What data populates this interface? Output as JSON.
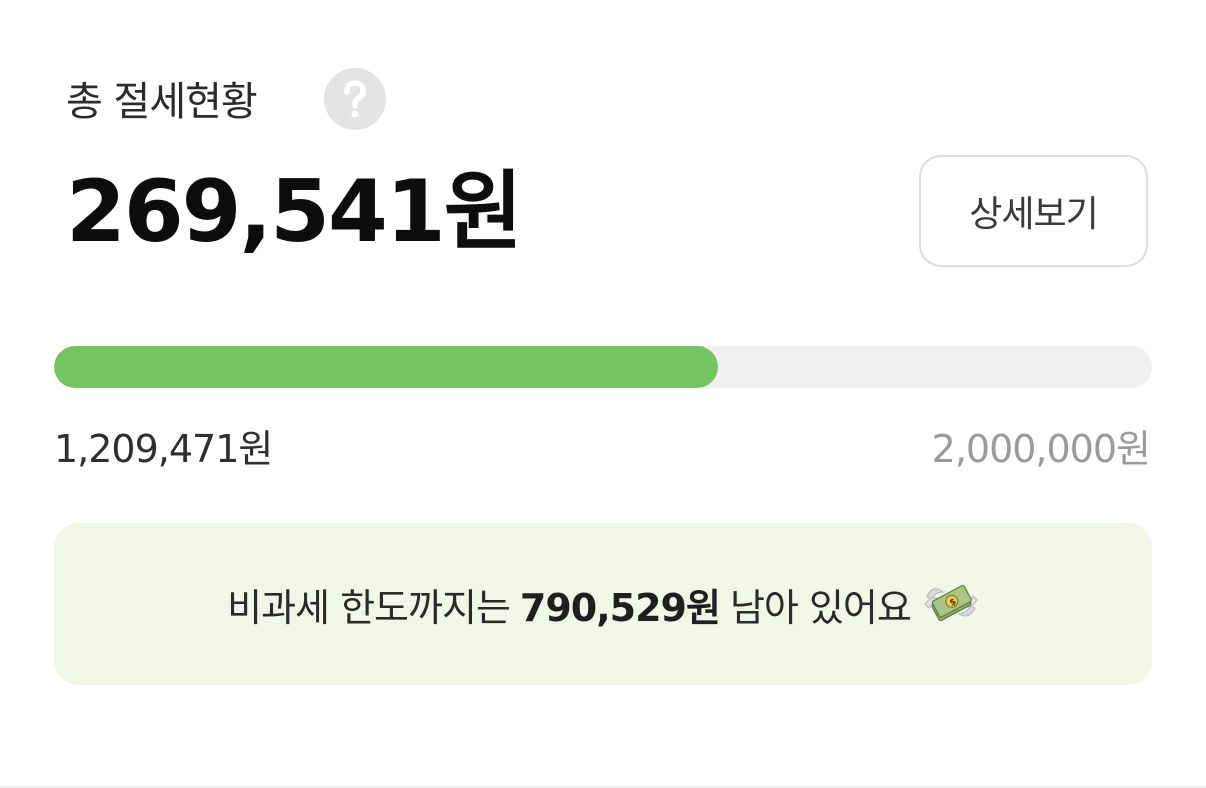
{
  "header": {
    "title": "총 절세현황",
    "help_icon": "question-circle-icon"
  },
  "summary": {
    "amount": "269,541원",
    "detail_button_label": "상세보기"
  },
  "progress": {
    "fraction": 0.6047,
    "current_label": "1,209,471원",
    "limit_label": "2,000,000원",
    "fill_color": "#75c462",
    "track_color": "#efefef"
  },
  "notice": {
    "prefix": "비과세 한도까지는",
    "remaining_amount": "790,529원",
    "suffix": "남아 있어요",
    "icon": "money-with-wings-icon",
    "background_color": "#f1f7e7"
  }
}
